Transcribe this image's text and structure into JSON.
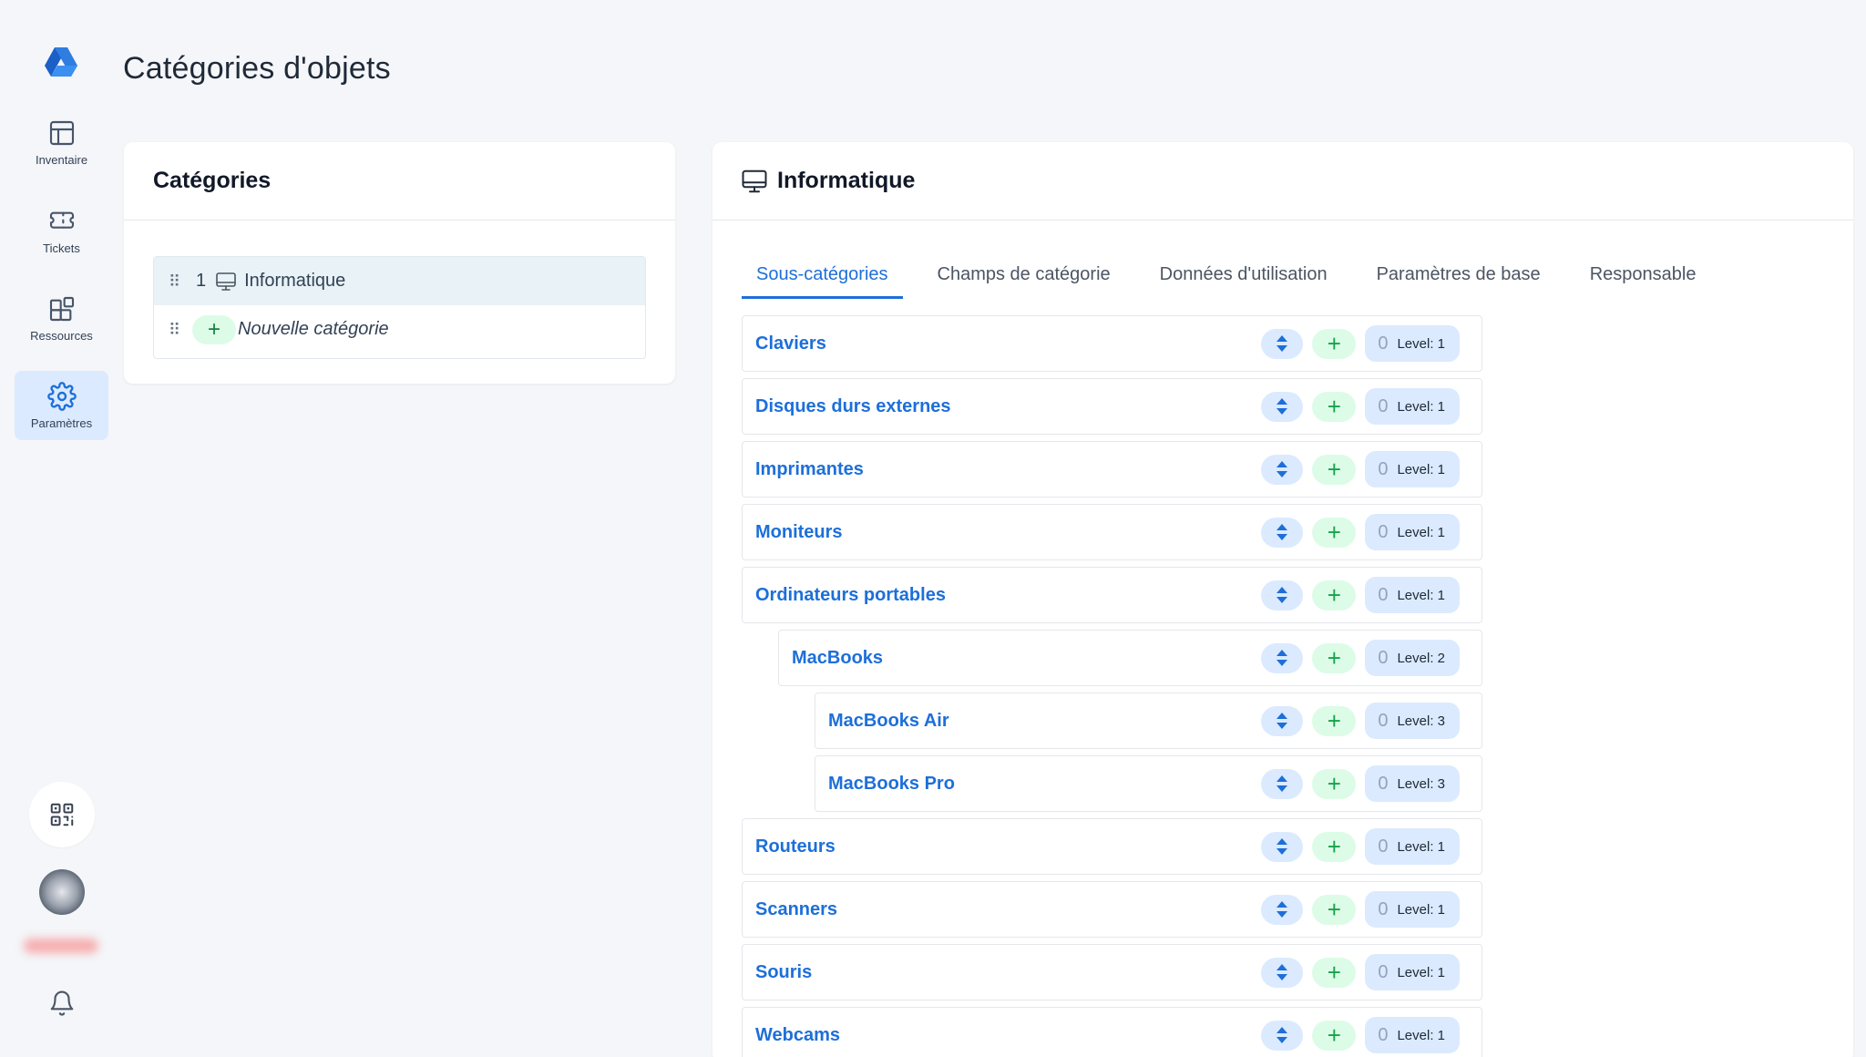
{
  "sidebar": {
    "logo_icon": "brand-logo-icon",
    "items": [
      {
        "label": "Inventaire",
        "icon": "table-icon"
      },
      {
        "label": "Tickets",
        "icon": "ticket-icon"
      },
      {
        "label": "Ressources",
        "icon": "blocks-icon"
      },
      {
        "label": "Paramètres",
        "icon": "gear-icon",
        "active": true
      }
    ],
    "qr_icon": "qr-code-icon",
    "bell_icon": "bell-icon"
  },
  "page": {
    "title": "Catégories d'objets"
  },
  "categories_card": {
    "title": "Catégories",
    "items": [
      {
        "number": "1",
        "label": "Informatique",
        "icon": "monitor-icon",
        "selected": true
      }
    ],
    "new_item": {
      "plus": "+",
      "label": "Nouvelle catégorie"
    }
  },
  "detail_card": {
    "title": "Informatique",
    "icon": "monitor-icon",
    "tabs": [
      {
        "label": "Sous-catégories",
        "active": true
      },
      {
        "label": "Champs de catégorie"
      },
      {
        "label": "Données d'utilisation"
      },
      {
        "label": "Paramètres de base"
      },
      {
        "label": "Responsable"
      }
    ],
    "subcategories": [
      {
        "name": "Claviers",
        "count": "0",
        "level": "Level: 1",
        "depth": 0
      },
      {
        "name": "Disques durs externes",
        "count": "0",
        "level": "Level: 1",
        "depth": 0
      },
      {
        "name": "Imprimantes",
        "count": "0",
        "level": "Level: 1",
        "depth": 0
      },
      {
        "name": "Moniteurs",
        "count": "0",
        "level": "Level: 1",
        "depth": 0
      },
      {
        "name": "Ordinateurs portables",
        "count": "0",
        "level": "Level: 1",
        "depth": 0
      },
      {
        "name": "MacBooks",
        "count": "0",
        "level": "Level: 2",
        "depth": 1
      },
      {
        "name": "MacBooks Air",
        "count": "0",
        "level": "Level: 3",
        "depth": 2
      },
      {
        "name": "MacBooks Pro",
        "count": "0",
        "level": "Level: 3",
        "depth": 2
      },
      {
        "name": "Routeurs",
        "count": "0",
        "level": "Level: 1",
        "depth": 0
      },
      {
        "name": "Scanners",
        "count": "0",
        "level": "Level: 1",
        "depth": 0
      },
      {
        "name": "Souris",
        "count": "0",
        "level": "Level: 1",
        "depth": 0
      },
      {
        "name": "Webcams",
        "count": "0",
        "level": "Level: 1",
        "depth": 0
      }
    ],
    "add_symbol": "+"
  },
  "colors": {
    "accent": "#1d6fd9",
    "active_bg": "#dbeafe",
    "add_bg": "#dcfce7"
  }
}
